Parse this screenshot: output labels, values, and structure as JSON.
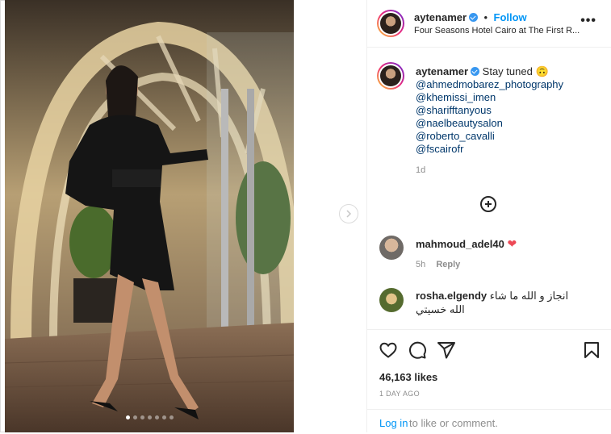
{
  "post": {
    "author": "aytenamer",
    "follow_separator": "•",
    "follow_label": "Follow",
    "location": "Four Seasons Hotel Cairo at The First R...",
    "more_label": "•••"
  },
  "caption": {
    "author": "aytenamer",
    "text": "Stay tuned 🙃",
    "mentions": [
      "@ahmedmobarez_photography",
      "@khemissi_imen",
      "@sharifftanyous",
      "@naelbeautysalon",
      "@roberto_cavalli",
      "@fscairofr"
    ],
    "age": "1d"
  },
  "comments": [
    {
      "author": "mahmoud_adel40",
      "text": "❤",
      "age": "5h",
      "reply_label": "Reply"
    },
    {
      "author": "rosha.elgendy",
      "text": "انجاز و الله ما شاء الله خسيتي"
    }
  ],
  "stats": {
    "likes": "46,163 likes",
    "posted": "1 DAY AGO"
  },
  "login": {
    "link": "Log in",
    "rest": "to like or comment."
  },
  "carousel": {
    "dot_count": 7,
    "active_index": 0
  },
  "colors": {
    "link": "#0095f6",
    "mention": "#00376b",
    "heart": "#ed4956",
    "muted": "#8e8e8e"
  },
  "icons": [
    "like-icon",
    "comment-icon",
    "share-icon",
    "save-icon",
    "more-icon",
    "add-comment-icon",
    "chevron-right-icon",
    "verified-icon"
  ]
}
